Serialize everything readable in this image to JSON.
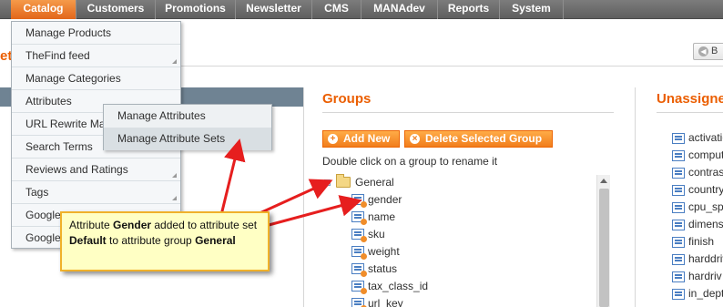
{
  "topnav": {
    "items": [
      {
        "label": "Catalog",
        "active": true
      },
      {
        "label": "Customers"
      },
      {
        "label": "Promotions"
      },
      {
        "label": "Newsletter"
      },
      {
        "label": "CMS"
      },
      {
        "label": "MANAdev"
      },
      {
        "label": "Reports"
      },
      {
        "label": "System"
      }
    ]
  },
  "page": {
    "title_fragment": "et",
    "back_button": "B"
  },
  "catalog_menu": {
    "items": [
      "Manage Products",
      "TheFind feed",
      "Manage Categories",
      "Attributes",
      "URL Rewrite Ma",
      "Search Terms",
      "Reviews and Ratings",
      "Tags",
      "Google",
      "Google"
    ]
  },
  "attributes_submenu": {
    "items": [
      "Manage Attributes",
      "Manage Attribute Sets"
    ],
    "highlighted": "Manage Attribute Sets"
  },
  "groups": {
    "title": "Groups",
    "add_button": "Add New",
    "delete_button": "Delete Selected Group",
    "hint": "Double click on a group to rename it",
    "tree": {
      "group": "General",
      "attributes": [
        "gender",
        "name",
        "sku",
        "weight",
        "status",
        "tax_class_id",
        "url_key"
      ]
    }
  },
  "unassigned": {
    "title": "Unassigne",
    "items": [
      "activatio",
      "compute",
      "contras",
      "country",
      "cpu_sp",
      "dimens",
      "finish",
      "harddriv",
      "hardriv",
      "in_dept"
    ]
  },
  "callout": {
    "prefix": "Attribute ",
    "attr": "Gender",
    "mid1": " added to attribute set ",
    "set": "Default",
    "mid2": " to attribute group ",
    "group": "General"
  },
  "colors": {
    "accent_orange": "#eb5e00",
    "nav_active": "#e2661a",
    "callout_bg": "#ffffc4",
    "arrow_red": "#e61e1e"
  }
}
